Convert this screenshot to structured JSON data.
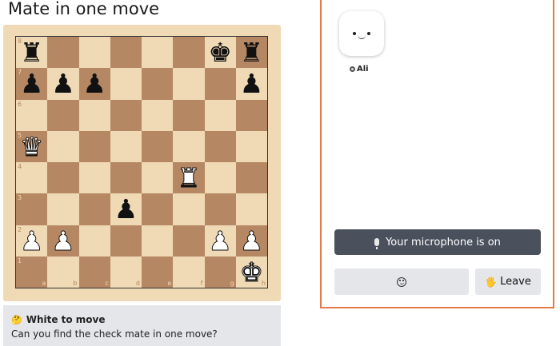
{
  "page": {
    "title": "Mate in one move"
  },
  "board": {
    "files": [
      "a",
      "b",
      "c",
      "d",
      "e",
      "f",
      "g",
      "h"
    ],
    "ranks": [
      "8",
      "7",
      "6",
      "5",
      "4",
      "3",
      "2",
      "1"
    ],
    "pieces": [
      {
        "square": "a8",
        "color": "black",
        "type": "rook",
        "glyph": "♜"
      },
      {
        "square": "g8",
        "color": "black",
        "type": "king",
        "glyph": "♚"
      },
      {
        "square": "h8",
        "color": "black",
        "type": "rook",
        "glyph": "♜"
      },
      {
        "square": "a7",
        "color": "black",
        "type": "pawn",
        "glyph": "♟"
      },
      {
        "square": "b7",
        "color": "black",
        "type": "pawn",
        "glyph": "♟"
      },
      {
        "square": "c7",
        "color": "black",
        "type": "pawn",
        "glyph": "♟"
      },
      {
        "square": "h7",
        "color": "black",
        "type": "pawn",
        "glyph": "♟"
      },
      {
        "square": "a5",
        "color": "white",
        "type": "queen",
        "glyph": "♛"
      },
      {
        "square": "f4",
        "color": "white",
        "type": "rook",
        "glyph": "♜"
      },
      {
        "square": "d3",
        "color": "black",
        "type": "pawn",
        "glyph": "♟"
      },
      {
        "square": "a2",
        "color": "white",
        "type": "pawn",
        "glyph": "♟"
      },
      {
        "square": "b2",
        "color": "white",
        "type": "pawn",
        "glyph": "♟"
      },
      {
        "square": "g2",
        "color": "white",
        "type": "pawn",
        "glyph": "♟"
      },
      {
        "square": "h2",
        "color": "white",
        "type": "pawn",
        "glyph": "♟"
      },
      {
        "square": "h1",
        "color": "white",
        "type": "king",
        "glyph": "♚"
      }
    ],
    "colors": {
      "light": "#f0d9b5",
      "dark": "#b58863"
    }
  },
  "info": {
    "icon": "thinking-face-icon",
    "heading": "White to move",
    "text": "Can you find the check mate in one move?"
  },
  "call": {
    "participant": {
      "name": "Ali",
      "avatar": "smiley-face-avatar"
    },
    "mic_label": "Your microphone is on",
    "emoji_icon": "smile-icon",
    "leave_label": "Leave",
    "leave_icon": "raised-hand-icon",
    "accent_color": "#e07b47"
  }
}
